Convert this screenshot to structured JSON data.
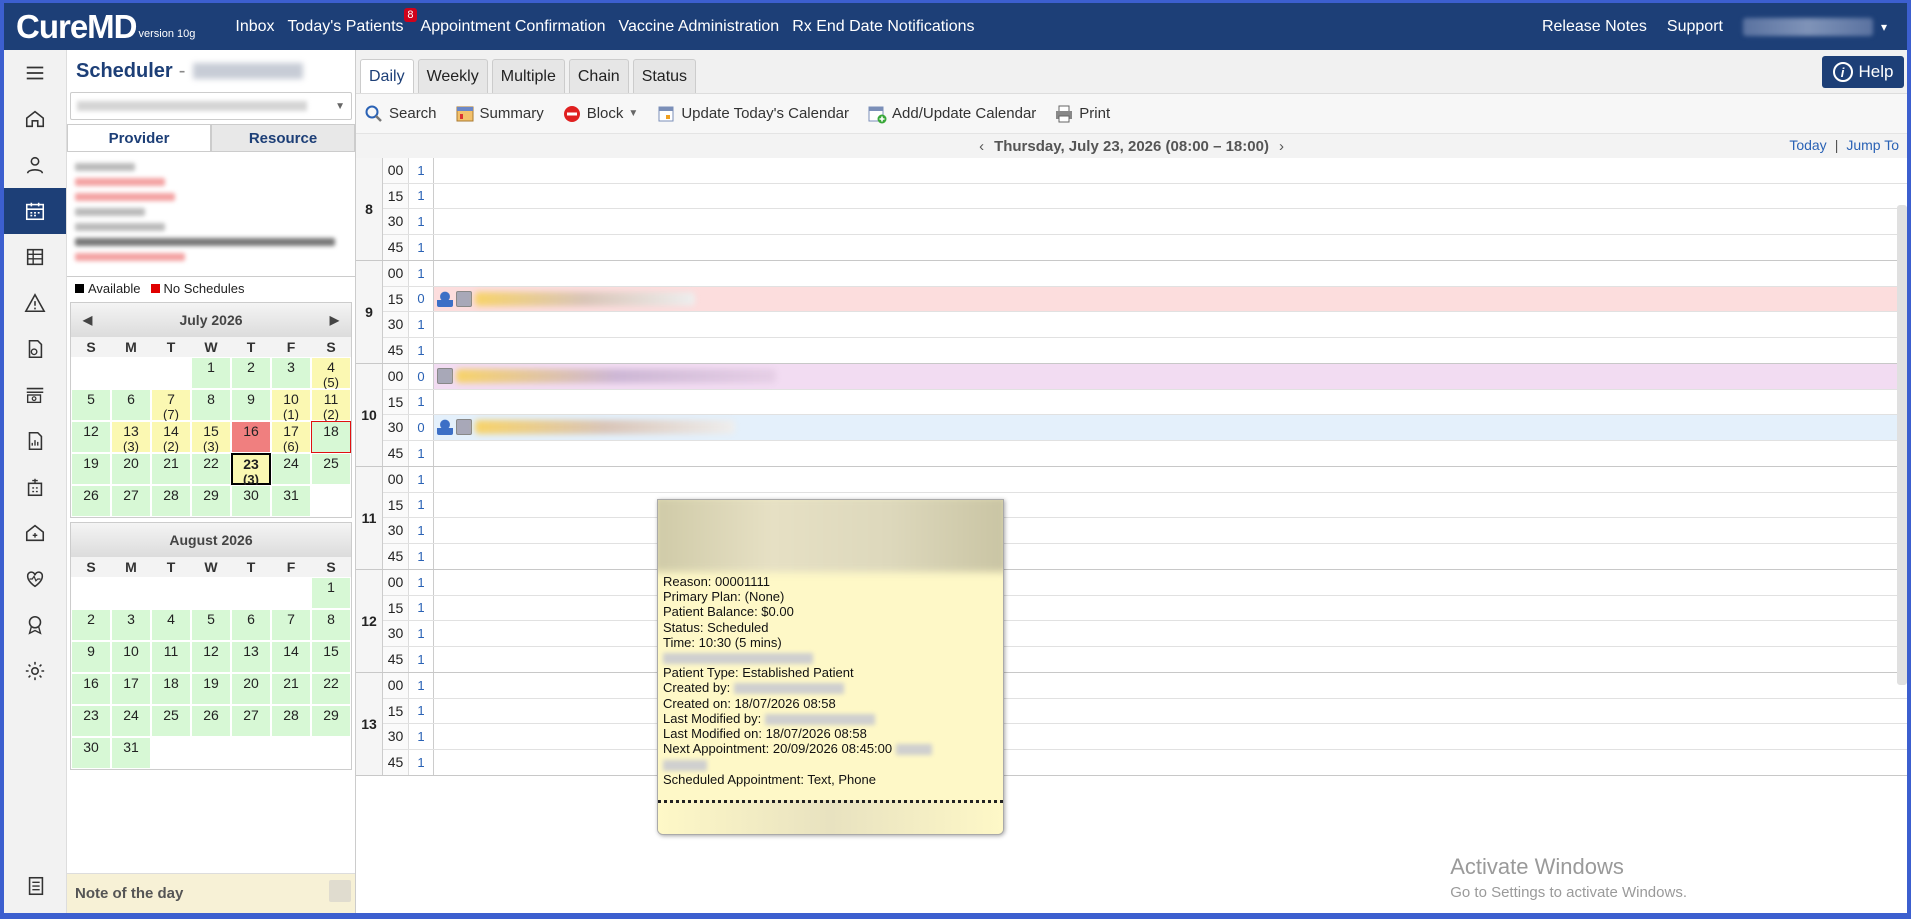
{
  "app": {
    "logo": "CureMD",
    "version": "version 10g"
  },
  "topnav": {
    "items": [
      "Inbox",
      "Today's Patients",
      "Appointment Confirmation",
      "Vaccine Administration",
      "Rx End Date Notifications"
    ],
    "todays_patients_badge": "8",
    "right": [
      "Release Notes",
      "Support"
    ]
  },
  "side": {
    "title": "Scheduler",
    "title_sep": "-",
    "tabs": [
      "Provider",
      "Resource"
    ],
    "legend": {
      "available": "Available",
      "no_schedules": "No Schedules",
      "available_color": "#000000",
      "no_schedules_color": "#e00000"
    },
    "cal1": {
      "month": "July 2026",
      "dow": [
        "S",
        "M",
        "T",
        "W",
        "T",
        "F",
        "S"
      ],
      "days": [
        {
          "d": "",
          "s": "empty"
        },
        {
          "d": "",
          "s": "empty"
        },
        {
          "d": "",
          "s": "empty"
        },
        {
          "d": "1",
          "s": "grn"
        },
        {
          "d": "2",
          "s": "grn"
        },
        {
          "d": "3",
          "s": "grn"
        },
        {
          "d": "4",
          "c": "(5)",
          "s": "yel"
        },
        {
          "d": "5",
          "s": "grn"
        },
        {
          "d": "6",
          "s": "grn"
        },
        {
          "d": "7",
          "c": "(7)",
          "s": "yel"
        },
        {
          "d": "8",
          "s": "grn"
        },
        {
          "d": "9",
          "s": "grn"
        },
        {
          "d": "10",
          "c": "(1)",
          "s": "yel"
        },
        {
          "d": "11",
          "c": "(2)",
          "s": "yel"
        },
        {
          "d": "12",
          "s": "grn"
        },
        {
          "d": "13",
          "c": "(3)",
          "s": "yel"
        },
        {
          "d": "14",
          "c": "(2)",
          "s": "yel"
        },
        {
          "d": "15",
          "c": "(3)",
          "s": "yel"
        },
        {
          "d": "16",
          "s": "red"
        },
        {
          "d": "17",
          "c": "(6)",
          "s": "yel"
        },
        {
          "d": "18",
          "s": "today"
        },
        {
          "d": "19",
          "s": "grn"
        },
        {
          "d": "20",
          "s": "grn"
        },
        {
          "d": "21",
          "s": "grn"
        },
        {
          "d": "22",
          "s": "grn"
        },
        {
          "d": "23",
          "c": "(3)",
          "s": "sel"
        },
        {
          "d": "24",
          "s": "grn"
        },
        {
          "d": "25",
          "s": "grn"
        },
        {
          "d": "26",
          "s": "grn"
        },
        {
          "d": "27",
          "s": "grn"
        },
        {
          "d": "28",
          "s": "grn"
        },
        {
          "d": "29",
          "s": "grn"
        },
        {
          "d": "30",
          "s": "grn"
        },
        {
          "d": "31",
          "s": "grn"
        },
        {
          "d": "",
          "s": "empty"
        }
      ]
    },
    "cal2": {
      "month": "August 2026",
      "dow": [
        "S",
        "M",
        "T",
        "W",
        "T",
        "F",
        "S"
      ],
      "days": [
        {
          "d": "",
          "s": "empty"
        },
        {
          "d": "",
          "s": "empty"
        },
        {
          "d": "",
          "s": "empty"
        },
        {
          "d": "",
          "s": "empty"
        },
        {
          "d": "",
          "s": "empty"
        },
        {
          "d": "",
          "s": "empty"
        },
        {
          "d": "1",
          "s": "grn"
        },
        {
          "d": "2",
          "s": "grn"
        },
        {
          "d": "3",
          "s": "grn"
        },
        {
          "d": "4",
          "s": "grn"
        },
        {
          "d": "5",
          "s": "grn"
        },
        {
          "d": "6",
          "s": "grn"
        },
        {
          "d": "7",
          "s": "grn"
        },
        {
          "d": "8",
          "s": "grn"
        },
        {
          "d": "9",
          "s": "grn"
        },
        {
          "d": "10",
          "s": "grn"
        },
        {
          "d": "11",
          "s": "grn"
        },
        {
          "d": "12",
          "s": "grn"
        },
        {
          "d": "13",
          "s": "grn"
        },
        {
          "d": "14",
          "s": "grn"
        },
        {
          "d": "15",
          "s": "grn"
        },
        {
          "d": "16",
          "s": "grn"
        },
        {
          "d": "17",
          "s": "grn"
        },
        {
          "d": "18",
          "s": "grn"
        },
        {
          "d": "19",
          "s": "grn"
        },
        {
          "d": "20",
          "s": "grn"
        },
        {
          "d": "21",
          "s": "grn"
        },
        {
          "d": "22",
          "s": "grn"
        },
        {
          "d": "23",
          "s": "grn"
        },
        {
          "d": "24",
          "s": "grn"
        },
        {
          "d": "25",
          "s": "grn"
        },
        {
          "d": "26",
          "s": "grn"
        },
        {
          "d": "27",
          "s": "grn"
        },
        {
          "d": "28",
          "s": "grn"
        },
        {
          "d": "29",
          "s": "grn"
        },
        {
          "d": "30",
          "s": "grn"
        },
        {
          "d": "31",
          "s": "grn"
        },
        {
          "d": "",
          "s": "empty"
        },
        {
          "d": "",
          "s": "empty"
        },
        {
          "d": "",
          "s": "empty"
        },
        {
          "d": "",
          "s": "empty"
        },
        {
          "d": "",
          "s": "empty"
        }
      ]
    },
    "note": "Note of the day"
  },
  "main": {
    "view_tabs": [
      "Daily",
      "Weekly",
      "Multiple",
      "Chain",
      "Status"
    ],
    "help": "Help",
    "toolbar": {
      "search": "Search",
      "summary": "Summary",
      "block": "Block",
      "update_today": "Update Today's Calendar",
      "add_update": "Add/Update Calendar",
      "print": "Print"
    },
    "date_label": "Thursday, July 23, 2026 (08:00 – 18:00)",
    "today_link": "Today",
    "jump_link": "Jump To",
    "hours": [
      {
        "h": "8",
        "slots": [
          {
            "m": "00",
            "c": "1"
          },
          {
            "m": "15",
            "c": "1"
          },
          {
            "m": "30",
            "c": "1"
          },
          {
            "m": "45",
            "c": "1"
          }
        ]
      },
      {
        "h": "9",
        "slots": [
          {
            "m": "00",
            "c": "1"
          },
          {
            "m": "15",
            "c": "0",
            "fill": "pink",
            "appt": "patient"
          },
          {
            "m": "30",
            "c": "1"
          },
          {
            "m": "45",
            "c": "1"
          }
        ]
      },
      {
        "h": "10",
        "slots": [
          {
            "m": "00",
            "c": "0",
            "fill": "purple",
            "appt": "note"
          },
          {
            "m": "15",
            "c": "1"
          },
          {
            "m": "30",
            "c": "0",
            "fill": "blue",
            "appt": "patient"
          },
          {
            "m": "45",
            "c": "1"
          }
        ]
      },
      {
        "h": "11",
        "slots": [
          {
            "m": "00",
            "c": "1"
          },
          {
            "m": "15",
            "c": "1"
          },
          {
            "m": "30",
            "c": "1"
          },
          {
            "m": "45",
            "c": "1"
          }
        ]
      },
      {
        "h": "12",
        "slots": [
          {
            "m": "00",
            "c": "1"
          },
          {
            "m": "15",
            "c": "1"
          },
          {
            "m": "30",
            "c": "1"
          },
          {
            "m": "45",
            "c": "1"
          }
        ]
      },
      {
        "h": "13",
        "slots": [
          {
            "m": "00",
            "c": "1"
          },
          {
            "m": "15",
            "c": "1"
          },
          {
            "m": "30",
            "c": "1"
          },
          {
            "m": "45",
            "c": "1"
          }
        ]
      }
    ]
  },
  "tooltip": {
    "reason": "Reason: 00001111",
    "primary_plan": "Primary Plan: (None)",
    "balance": "Patient Balance: $0.00",
    "status": "Status: Scheduled",
    "time": "Time: 10:30 (5 mins)",
    "patient_type": "Patient Type: Established Patient",
    "created_by": "Created by:",
    "created_on": "Created on: 18/07/2026 08:58",
    "modified_by": "Last Modified by:",
    "modified_on": "Last Modified on: 18/07/2026 08:58",
    "next_appt": "Next Appointment: 20/09/2026 08:45:00",
    "scheduled_appt": "Scheduled Appointment: Text, Phone"
  },
  "watermark": {
    "line1": "Activate Windows",
    "line2": "Go to Settings to activate Windows."
  },
  "colors": {
    "brand": "#1d3f77",
    "available": "#d7f8d5",
    "partial": "#fbf8b2",
    "no_schedule": "#f07f7f"
  }
}
